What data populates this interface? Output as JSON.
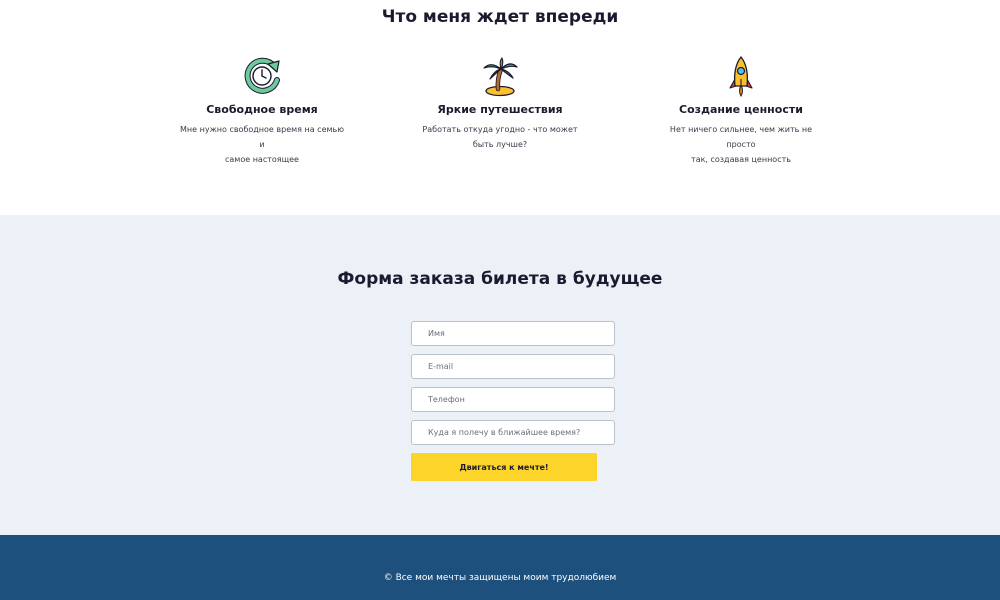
{
  "features_section": {
    "title": "Что меня ждет впереди",
    "items": [
      {
        "icon": "clock-cycle-icon",
        "title": "Свободное время",
        "text_line1": "Мне нужно свободное время на семью и",
        "text_line2": "самое настоящее"
      },
      {
        "icon": "palm-island-icon",
        "title": "Яркие путешествия",
        "text_line1": "Работать откуда угодно - что может",
        "text_line2": "быть лучше?"
      },
      {
        "icon": "rocket-icon",
        "title": "Создание ценности",
        "text_line1": "Нет ничего сильнее, чем жить не просто",
        "text_line2": "так, создавая ценность"
      }
    ]
  },
  "form_section": {
    "title": "Форма заказа билета в будущее",
    "name_placeholder": "Имя",
    "email_placeholder": "E-mail",
    "phone_placeholder": "Телефон",
    "destination_placeholder": "Куда я полечу в ближайшее время?",
    "submit_label": "Двигаться к мечте!"
  },
  "footer": {
    "text": "© Все мои мечты защищены моим трудолюбием"
  },
  "colors": {
    "form_background": "#ecf1f7",
    "footer_background": "#1d507d",
    "button_accent": "#fdd42a",
    "clock_icon": "#6ec99b"
  }
}
